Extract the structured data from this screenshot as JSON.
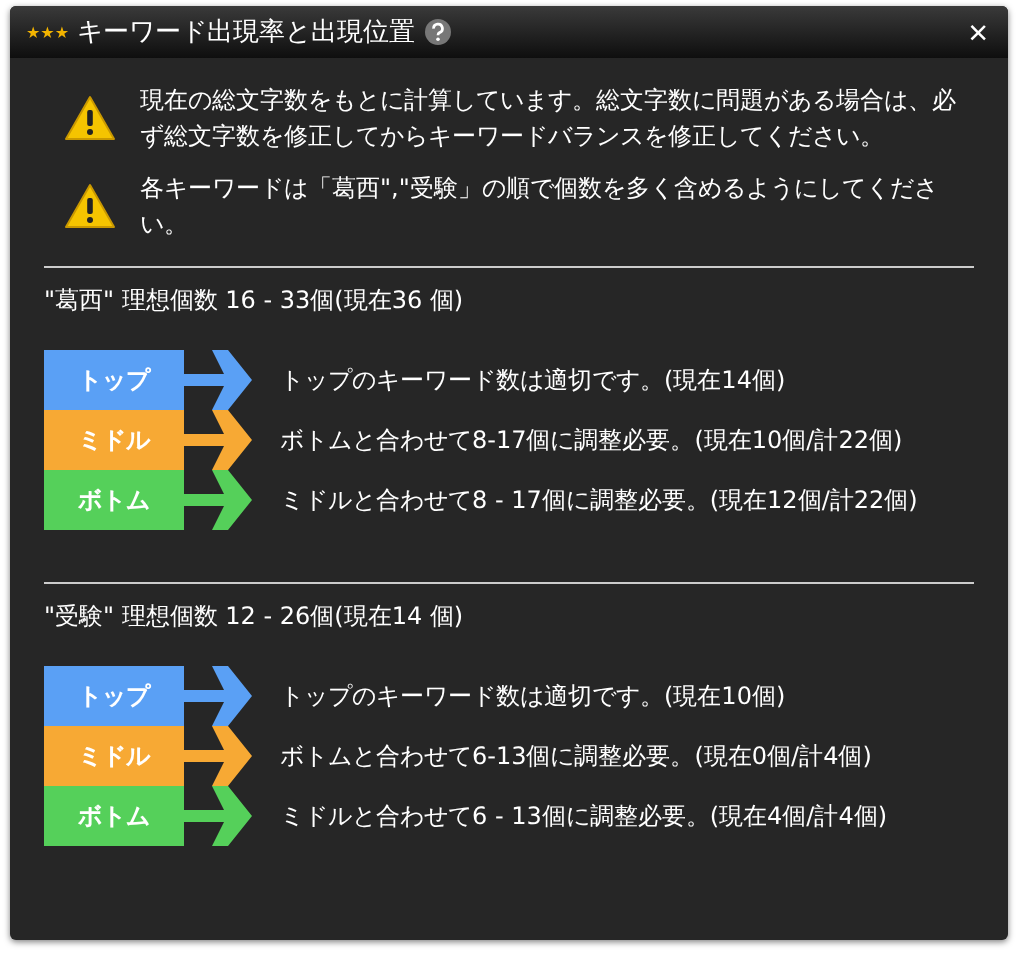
{
  "window": {
    "stars": "★★★",
    "title": "キーワード出現率と出現位置",
    "close": "×"
  },
  "warnings": [
    "現在の総文字数をもとに計算しています。総文字数に問題がある場合は、必ず総文字数を修正してからキーワードバランスを修正してください。",
    "各キーワードは「葛西\",\"受験」の順で個数を多く含めるようにしてください。"
  ],
  "sections": [
    {
      "heading": "\"葛西\" 理想個数 16 - 33個(現在36 個)",
      "rows": [
        {
          "label": "トップ",
          "color": "#5aa0f5",
          "message": "トップのキーワード数は適切です。(現在14個)"
        },
        {
          "label": "ミドル",
          "color": "#f7a934",
          "message": "ボトムと合わせて8-17個に調整必要。(現在10個/計22個)"
        },
        {
          "label": "ボトム",
          "color": "#55d05a",
          "message": "ミドルと合わせて8 - 17個に調整必要。(現在12個/計22個)"
        }
      ]
    },
    {
      "heading": "\"受験\" 理想個数 12 - 26個(現在14 個)",
      "rows": [
        {
          "label": "トップ",
          "color": "#5aa0f5",
          "message": "トップのキーワード数は適切です。(現在10個)"
        },
        {
          "label": "ミドル",
          "color": "#f7a934",
          "message": "ボトムと合わせて6-13個に調整必要。(現在0個/計4個)"
        },
        {
          "label": "ボトム",
          "color": "#55d05a",
          "message": "ミドルと合わせて6 - 13個に調整必要。(現在4個/計4個)"
        }
      ]
    }
  ]
}
